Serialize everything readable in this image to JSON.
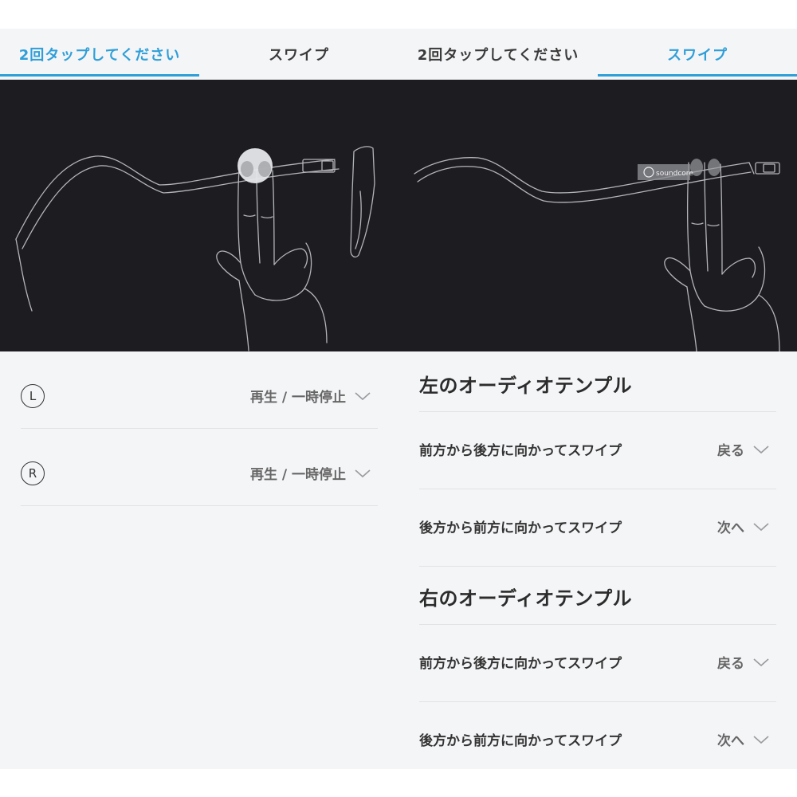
{
  "colors": {
    "accent": "#2f9fd8",
    "panel_bg": "#f4f5f7",
    "illustration_bg": "#1d1d21"
  },
  "left_panel": {
    "tabs": [
      {
        "label": "2回タップしてください",
        "active": true
      },
      {
        "label": "スワイプ",
        "active": false
      }
    ],
    "rows": [
      {
        "side": "L",
        "action": "再生 / 一時停止"
      },
      {
        "side": "R",
        "action": "再生 / 一時停止"
      }
    ]
  },
  "right_panel": {
    "tabs": [
      {
        "label": "2回タップしてください",
        "active": false
      },
      {
        "label": "スワイプ",
        "active": true
      }
    ],
    "brand_label": "soundcore",
    "sections": [
      {
        "title": "左のオーディオテンプル",
        "rows": [
          {
            "gesture": "前方から後方に向かってスワイプ",
            "action": "戻る"
          },
          {
            "gesture": "後方から前方に向かってスワイプ",
            "action": "次へ"
          }
        ]
      },
      {
        "title": "右のオーディオテンプル",
        "rows": [
          {
            "gesture": "前方から後方に向かってスワイプ",
            "action": "戻る"
          },
          {
            "gesture": "後方から前方に向かってスワイプ",
            "action": "次へ"
          }
        ]
      }
    ]
  }
}
